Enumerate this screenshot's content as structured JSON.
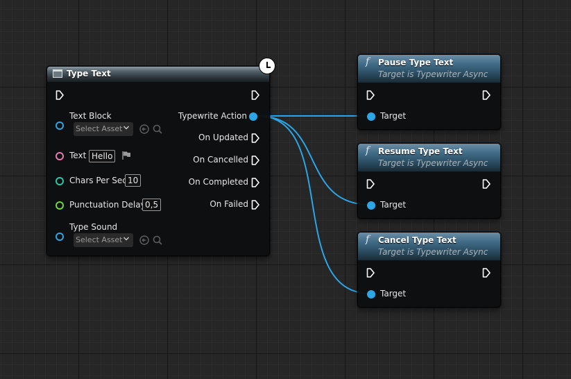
{
  "type_text_node": {
    "title": "Type Text",
    "inputs": {
      "text_block": {
        "label": "Text Block",
        "placeholder": "Select Asset"
      },
      "text": {
        "label": "Text",
        "value": "Hello"
      },
      "chars_per_sec": {
        "label": "Chars Per Sec",
        "value": "10"
      },
      "punctuation_delay": {
        "label": "Punctuation Delay",
        "value": "0,5"
      },
      "type_sound": {
        "label": "Type Sound",
        "placeholder": "Select Asset"
      }
    },
    "outputs": {
      "typewrite_action": "Typewrite Action",
      "on_updated": "On Updated",
      "on_cancelled": "On Cancelled",
      "on_completed": "On Completed",
      "on_failed": "On Failed"
    }
  },
  "function_nodes": [
    {
      "title": "Pause Type Text",
      "subtitle": "Target is Typewriter Async",
      "pin_label": "Target"
    },
    {
      "title": "Resume Type Text",
      "subtitle": "Target is Typewriter Async",
      "pin_label": "Target"
    },
    {
      "title": "Cancel Type Text",
      "subtitle": "Target is Typewriter Async",
      "pin_label": "Target"
    }
  ],
  "colors": {
    "object_pin": "#2ba6e6",
    "text_pin": "#e879b0",
    "float_pin": "#26c9a6",
    "float_pin_2": "#6bd83a",
    "wire": "#2ba6e6"
  },
  "icons": {
    "clock": "clock-icon",
    "function": "function-glyph",
    "exec": "exec-pin-icon",
    "browse": "browse-arrow-icon",
    "search": "search-icon",
    "flag": "localization-flag-icon",
    "chevron": "chevron-down-icon"
  }
}
